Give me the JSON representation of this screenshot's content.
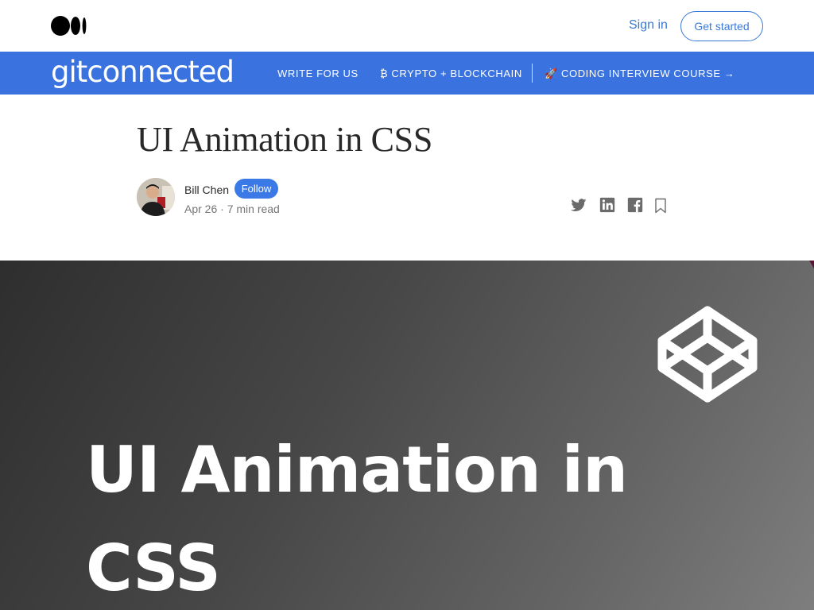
{
  "header": {
    "logo_icon": "medium-logo-icon",
    "sign_in_label": "Sign in",
    "get_started_label": "Get started"
  },
  "publication": {
    "name": "gitconnected",
    "background_color": "#3a72e0",
    "nav": [
      {
        "label": "WRITE FOR US"
      },
      {
        "label": "₿ CRYPTO + BLOCKCHAIN",
        "icon": "bitcoin-icon"
      },
      {
        "label": "🚀 CODING INTERVIEW COURSE →",
        "icon": "rocket-icon"
      }
    ]
  },
  "article": {
    "title": "UI Animation in CSS",
    "author": "Bill Chen",
    "follow_label": "Follow",
    "meta": "Apr 26 · 7 min read",
    "share_icons": [
      "twitter-icon",
      "linkedin-icon",
      "facebook-icon",
      "bookmark-icon"
    ]
  },
  "hero": {
    "title_line1": "UI Animation in",
    "title_line2": "CSS",
    "icon": "codepen-logo-icon"
  }
}
